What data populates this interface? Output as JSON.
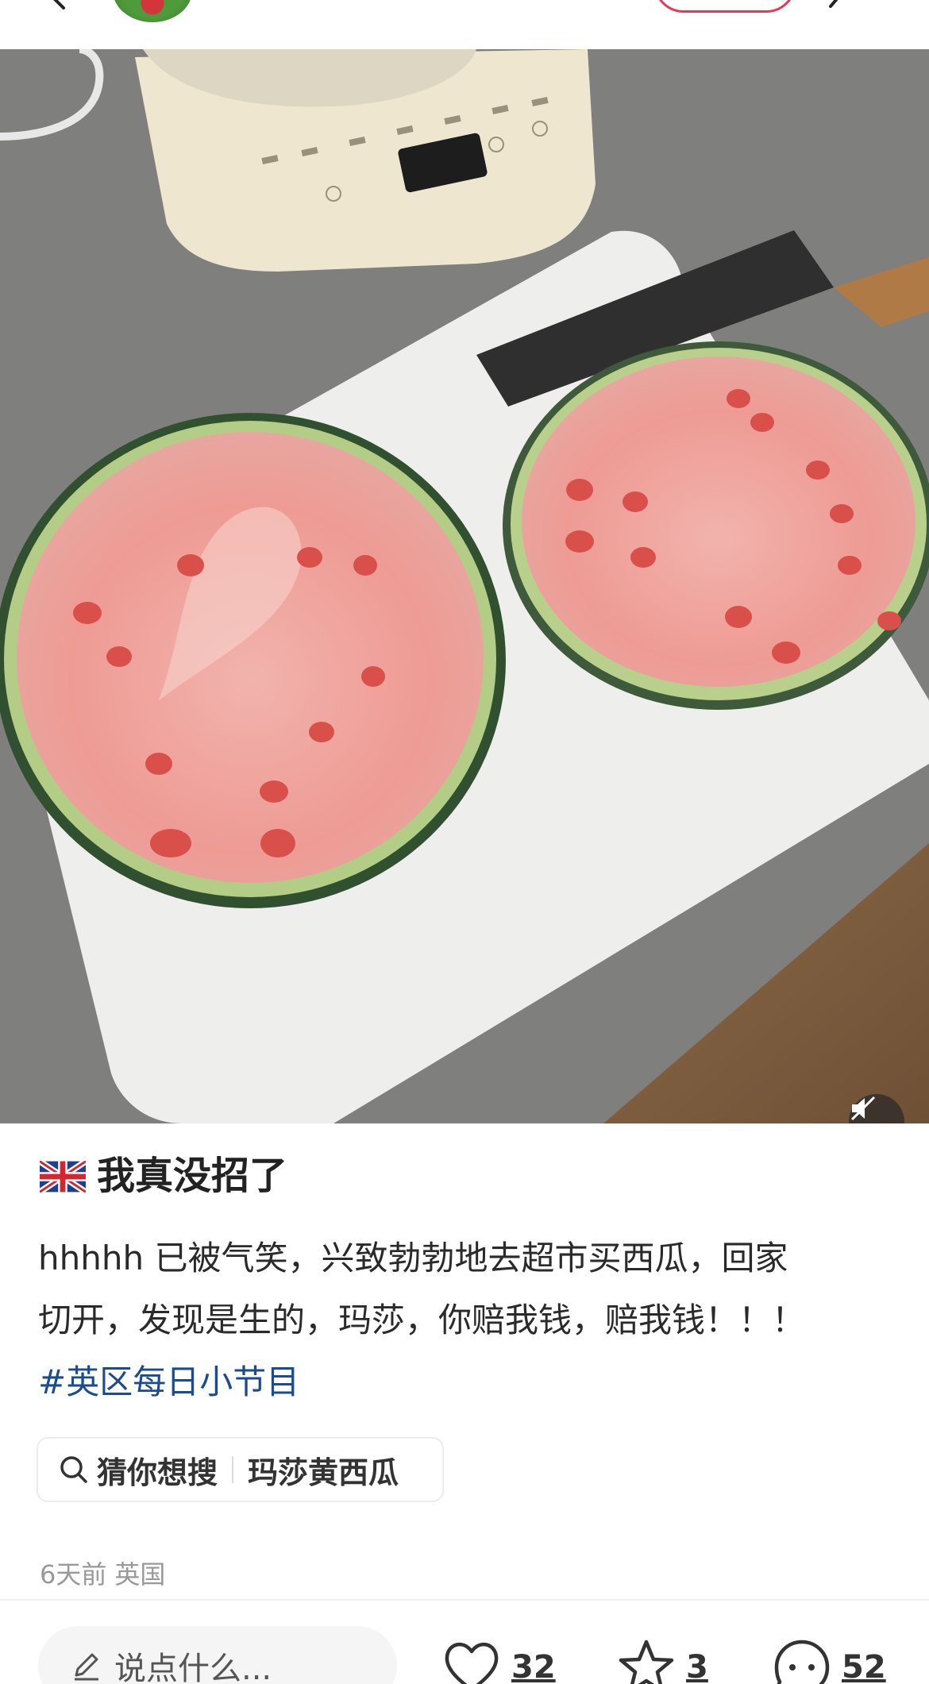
{
  "app": {
    "accent_color": "#e6395a",
    "hashtag_color": "#1c4b8f"
  },
  "header": {
    "back_icon": "chevron-left-icon",
    "share_icon": "share-icon"
  },
  "photo": {
    "mute_icon": "speaker-muted-icon"
  },
  "post": {
    "flag_icon": "uk-flag-icon",
    "title": "我真没招了",
    "body_line1": "hhhhh 已被气笑，兴致勃勃地去超市买西瓜，回家",
    "body_line2": "切开，发现是生的，玛莎，你赔我钱，赔我钱！！！",
    "hashtag": "#英区每日小节目"
  },
  "suggest": {
    "label": "猜你想搜",
    "term": "玛莎黄西瓜"
  },
  "meta": {
    "time": "6天前",
    "location": "英国"
  },
  "bottom_bar": {
    "comment_placeholder": "说点什么...",
    "likes": "32",
    "favorites": "3",
    "comments": "52"
  }
}
